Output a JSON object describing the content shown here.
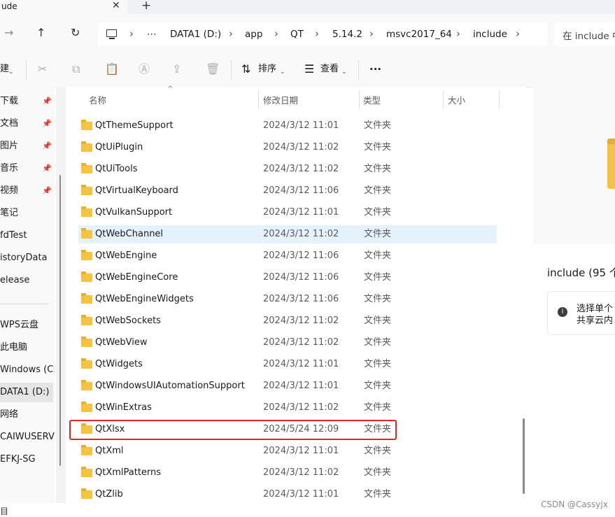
{
  "tab": {
    "title": "ude",
    "close": "✕",
    "new_tab": "+"
  },
  "nav": {
    "back": "←",
    "forward": "→",
    "up": "↑",
    "refresh": "↻"
  },
  "address": {
    "pc_icon": "computer-icon",
    "more": "⋯",
    "crumbs": [
      "DATA1 (D:)",
      "app",
      "QT",
      "5.14.2",
      "msvc2017_64",
      "include"
    ],
    "sep": "›"
  },
  "search": {
    "placeholder": "在 include 中"
  },
  "toolbar": {
    "new_label": "建",
    "sort_label": "排序",
    "view_label": "查看",
    "more": "···"
  },
  "sidebar": {
    "items": [
      {
        "label": "下载",
        "pinned": true
      },
      {
        "label": "文档",
        "pinned": true
      },
      {
        "label": "图片",
        "pinned": true
      },
      {
        "label": "音乐",
        "pinned": true
      },
      {
        "label": "视频",
        "pinned": true
      },
      {
        "label": "笔记",
        "pinned": false
      },
      {
        "label": "fdTest",
        "pinned": false
      },
      {
        "label": "istoryData",
        "pinned": false
      },
      {
        "label": "elease",
        "pinned": false
      },
      {
        "label": "WPS云盘",
        "pinned": false
      },
      {
        "label": "此电脑",
        "pinned": false
      },
      {
        "label": "Windows (C:)",
        "pinned": false
      },
      {
        "label": "DATA1 (D:)",
        "pinned": false,
        "selected": true
      },
      {
        "label": "网络",
        "pinned": false
      },
      {
        "label": "CAIWUSERVE",
        "pinned": false
      },
      {
        "label": "EFKJ-SG",
        "pinned": false
      }
    ],
    "pin_glyph": "📌"
  },
  "columns": {
    "name": "名称",
    "date": "修改日期",
    "type": "类型",
    "size": "大小"
  },
  "files": [
    {
      "name": "QtThemeSupport",
      "date": "2024/3/12 11:01",
      "type": "文件夹"
    },
    {
      "name": "QtUiPlugin",
      "date": "2024/3/12 11:02",
      "type": "文件夹"
    },
    {
      "name": "QtUiTools",
      "date": "2024/3/12 11:02",
      "type": "文件夹"
    },
    {
      "name": "QtVirtualKeyboard",
      "date": "2024/3/12 11:06",
      "type": "文件夹"
    },
    {
      "name": "QtVulkanSupport",
      "date": "2024/3/12 11:01",
      "type": "文件夹"
    },
    {
      "name": "QtWebChannel",
      "date": "2024/3/12 11:02",
      "type": "文件夹"
    },
    {
      "name": "QtWebEngine",
      "date": "2024/3/12 11:06",
      "type": "文件夹"
    },
    {
      "name": "QtWebEngineCore",
      "date": "2024/3/12 11:06",
      "type": "文件夹"
    },
    {
      "name": "QtWebEngineWidgets",
      "date": "2024/3/12 11:06",
      "type": "文件夹"
    },
    {
      "name": "QtWebSockets",
      "date": "2024/3/12 11:02",
      "type": "文件夹"
    },
    {
      "name": "QtWebView",
      "date": "2024/3/12 11:02",
      "type": "文件夹"
    },
    {
      "name": "QtWidgets",
      "date": "2024/3/12 11:01",
      "type": "文件夹"
    },
    {
      "name": "QtWindowsUIAutomationSupport",
      "date": "2024/3/12 11:01",
      "type": "文件夹"
    },
    {
      "name": "QtWinExtras",
      "date": "2024/3/12 11:02",
      "type": "文件夹"
    },
    {
      "name": "QtXlsx",
      "date": "2024/5/24 12:09",
      "type": "文件夹"
    },
    {
      "name": "QtXml",
      "date": "2024/3/12 11:01",
      "type": "文件夹"
    },
    {
      "name": "QtXmlPatterns",
      "date": "2024/3/12 11:02",
      "type": "文件夹"
    },
    {
      "name": "QtZlib",
      "date": "2024/3/12 11:01",
      "type": "文件夹"
    }
  ],
  "details": {
    "title": "include (95 个",
    "info_line1": "选择单个",
    "info_line2": "共享云内"
  },
  "watermark": "CSDN @Cassyjx",
  "bottom_left": "目",
  "colors": {
    "highlight_border": "#e8231f",
    "folder": "#f5c342",
    "hover_row": "#e5f1fb"
  }
}
